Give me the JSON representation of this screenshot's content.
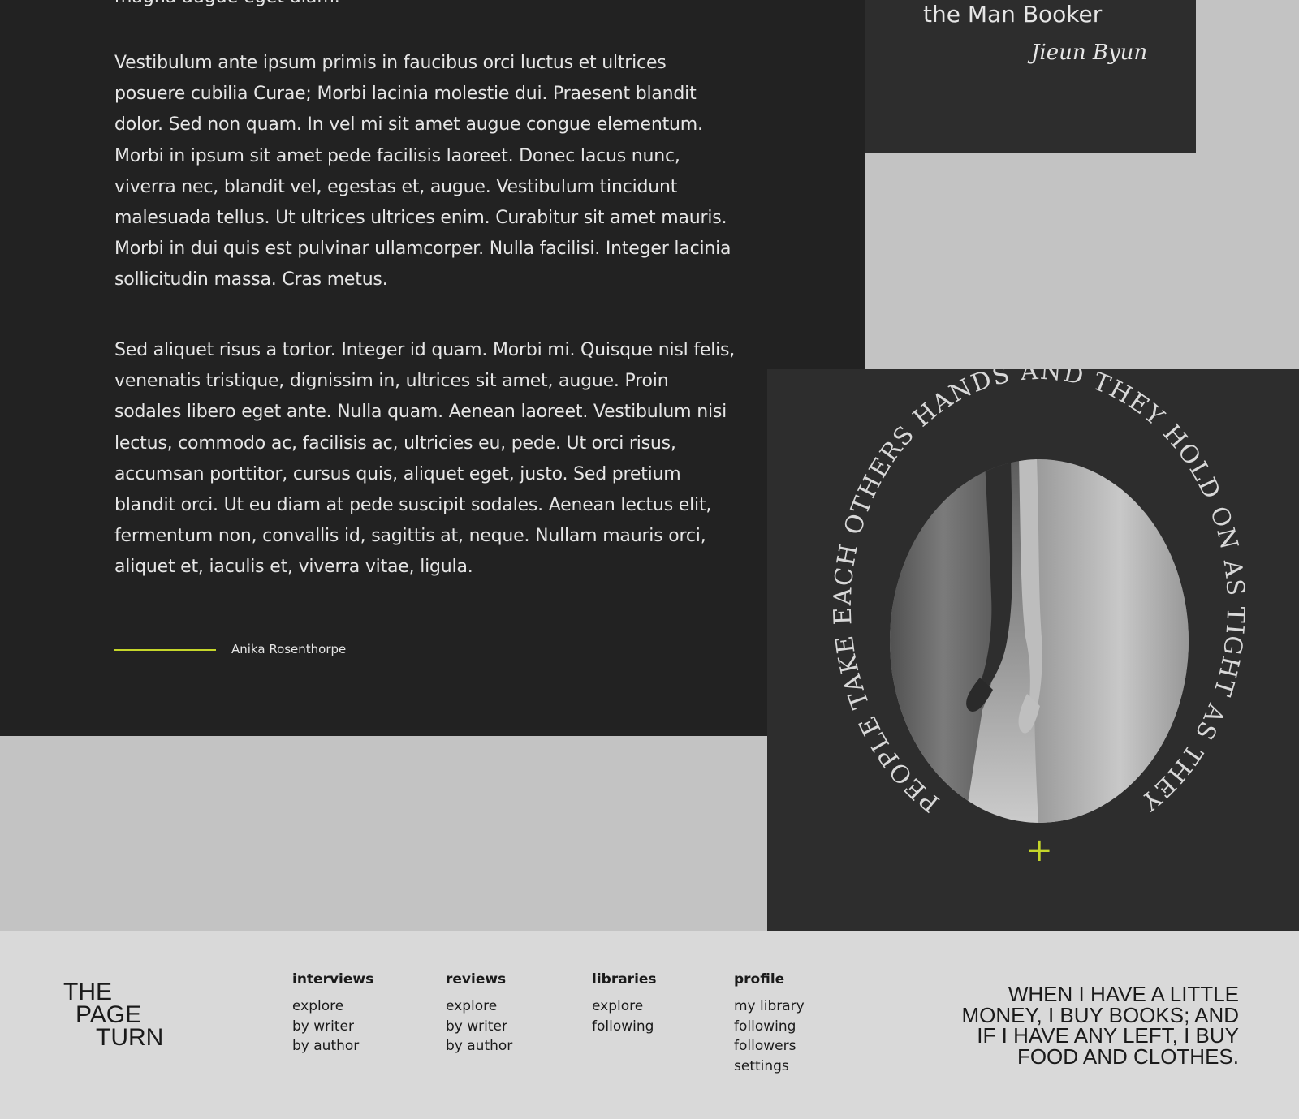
{
  "article": {
    "cut_line": "magna augue eget diam.",
    "paragraphs": [
      "Vestibulum ante ipsum primis in faucibus orci luctus et ultrices\nposuere cubilia Curae; Morbi lacinia molestie dui. Praesent blandit\ndolor. Sed non quam. In vel mi sit amet augue congue elementum.\nMorbi in ipsum sit amet pede facilisis laoreet. Donec lacus nunc,\nviverra nec, blandit vel, egestas et, augue. Vestibulum tincidunt\nmalesuada tellus. Ut ultrices ultrices enim. Curabitur sit amet mauris.\nMorbi in dui quis est pulvinar ullamcorper. Nulla facilisi. Integer lacinia\nsollicitudin massa. Cras metus.",
      "Sed aliquet risus a tortor. Integer id quam. Morbi mi. Quisque nisl felis,\nvenenatis tristique, dignissim in, ultrices sit amet, augue. Proin\nsodales libero eget ante. Nulla quam. Aenean laoreet. Vestibulum nisi\nlectus, commodo ac, facilisis ac, ultricies eu, pede. Ut orci risus,\naccumsan porttitor, cursus quis, aliquet eget, justo. Sed pretium\nblandit orci. Ut eu diam at pede suscipit sodales. Aenean lectus elit,\nfermentum non, convallis id, sagittis at, neque. Nullam mauris orci,\naliquet et, iaculis et, viverra vitae, ligula."
    ],
    "author": "Anika Rosenthorpe"
  },
  "quote_card": {
    "text_end": "the Man Booker",
    "signature": "Jieun Byun"
  },
  "art_card": {
    "circular_text": "PEOPLE TAKE EACH OTHERS HANDS AND THEY HOLD ON AS TIGHT AS THEY CAN",
    "plus_symbol": "+"
  },
  "footer": {
    "logo": [
      "THE",
      "PAGE",
      "TURN"
    ],
    "columns": [
      {
        "title": "interviews",
        "links": [
          "explore",
          "by writer",
          "by author"
        ]
      },
      {
        "title": "reviews",
        "links": [
          "explore",
          "by writer",
          "by author"
        ]
      },
      {
        "title": "libraries",
        "links": [
          "explore",
          "following"
        ]
      },
      {
        "title": "profile",
        "links": [
          "my library",
          "following",
          "followers",
          "settings"
        ]
      }
    ],
    "quote": "WHEN I HAVE A LITTLE\nMONEY, I BUY BOOKS; AND\nIF I HAVE ANY LEFT, I BUY\nFOOD  AND CLOTHES."
  },
  "colors": {
    "article_bg": "#222222",
    "card_bg": "#2d2d2d",
    "page_bg": "#c3c3c3",
    "footer_bg": "#d9d9d9",
    "accent": "#c5d62a"
  }
}
